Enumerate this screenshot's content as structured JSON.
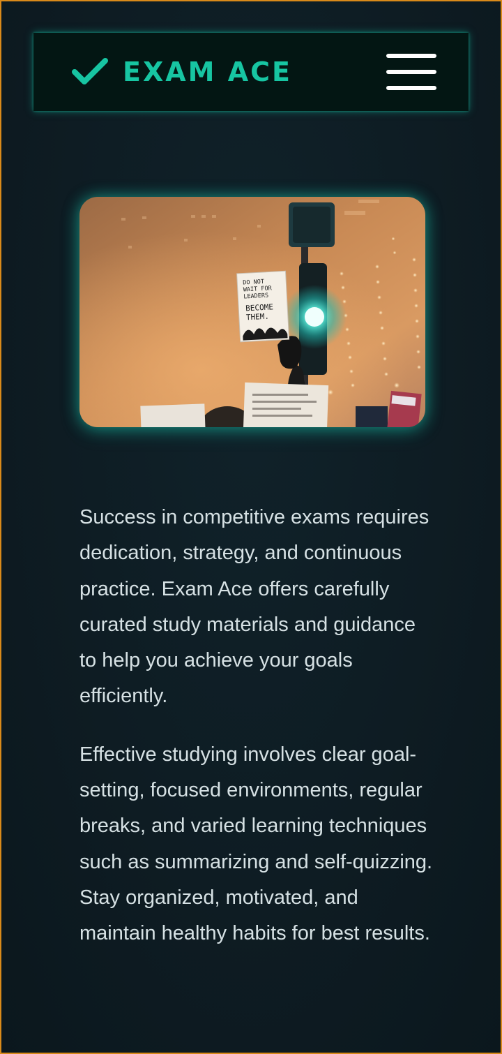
{
  "brand": {
    "name": "EXAM ACE",
    "logo_icon": "checkmark-icon",
    "color": "#17c5a2"
  },
  "nav": {
    "menu_icon": "hamburger-menu-icon"
  },
  "hero": {
    "alt": "Protest crowd holding a sign under a traffic light",
    "sign_text": [
      "DO NOT",
      "WAIT FOR",
      "LEADERS",
      "BECOME",
      "THEM."
    ]
  },
  "content": {
    "paragraphs": [
      "Success in competitive exams requires dedication, strategy, and continuous practice. Exam Ace offers carefully curated study materials and guidance to help you achieve your goals efficiently.",
      "Effective studying involves clear goal-setting, focused environments, regular breaks, and varied learning techniques such as summarizing and self-quizzing. Stay organized, motivated, and maintain healthy habits for best results."
    ]
  },
  "theme": {
    "background": "#0d1a20",
    "navbar_background": "#031613",
    "accent_glow": "#19c8af",
    "border": "#d98a1a",
    "text": "#d6e1e4"
  }
}
